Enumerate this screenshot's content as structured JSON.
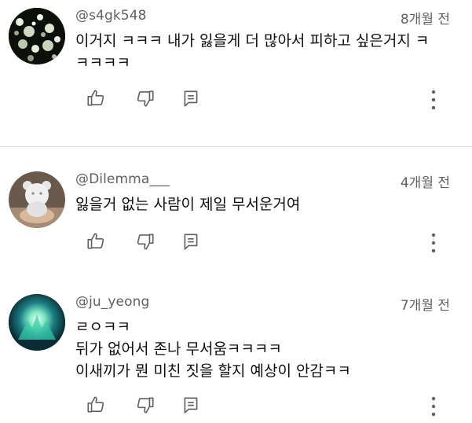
{
  "comments": [
    {
      "author": "@s4gk548",
      "time": "8개월 전",
      "lines": [
        "이거지 ㅋㅋㅋ 내가 잃을게 더 많아서 피하고 싶은거지 ㅋ",
        "ㅋㅋㅋㅋ"
      ]
    },
    {
      "author": "@Dilemma___",
      "time": "4개월 전",
      "lines": [
        "잃을거 없는 사람이 제일 무서운거여"
      ]
    },
    {
      "author": "@ju_yeong",
      "time": "7개월 전",
      "lines": [
        "ㄹㅇㅋㅋ",
        "뒤가 없어서 존나 무서움ㅋㅋㅋㅋ",
        "이새끼가 뭔 미친 짓을 할지 예상이 안감ㅋㅋ"
      ]
    }
  ],
  "icons": {
    "like": "thumbs-up-icon",
    "dislike": "thumbs-down-icon",
    "reply": "reply-icon",
    "more": "more-vertical-icon"
  },
  "colors": {
    "text": "#0f0f0f",
    "meta": "#606060",
    "icon": "#606060",
    "divider": "#e5e5e5"
  }
}
